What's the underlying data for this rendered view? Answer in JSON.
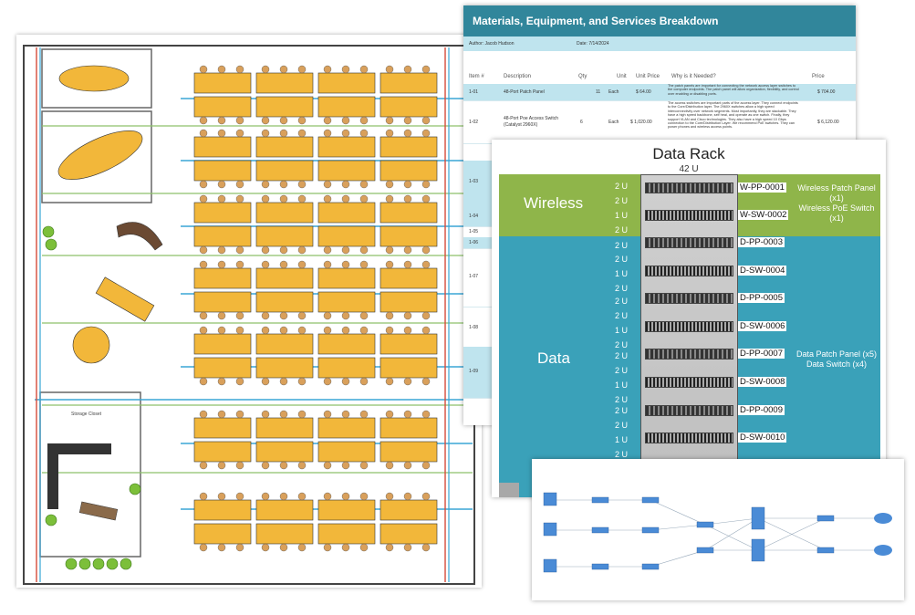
{
  "spreadsheet": {
    "title": "Materials, Equipment, and Services Breakdown",
    "author": "Author: Jacob Hudson",
    "date": "Date: 7/14/2024",
    "headers": [
      "Item #",
      "Description",
      "Qty",
      "Unit",
      "Unit Price",
      "Why is it Needed?",
      "Price"
    ],
    "rows": [
      {
        "item": "1-01",
        "description": "48-Port Patch Panel",
        "qty": "11",
        "unit": "Each",
        "unit_price": "$ 64.00",
        "why": "The patch panels are important for connecting the network access layer switches to the computer endpoints. The patch panel will allow organization, flexibility, and control over enabling or disabling ports.",
        "price": "$ 704.00"
      },
      {
        "item": "1-02",
        "description": "48-Port Poe Access Switch (Catalyst 2960X)",
        "qty": "6",
        "unit": "Each",
        "unit_price": "$ 1,020.00",
        "why": "The access switches are important parts of the access layer. They connect endpoints to the Core/Distribution layer. The 2960X switches allow a high speed interconnectivity over network segments. Most importantly, they are stackable. They have a high speed backbone, self heal, and operate as one switch. Finally, they support VLAN and Cisco technologies. They also have a high speed 10 Gbps connection to the Core/Distribution Layer. We recommend PoE switches. They can power phones and wireless access points.",
        "price": "$ 6,120.00"
      },
      {
        "item": "1-03"
      },
      {
        "item": "1-04"
      },
      {
        "item": "1-05"
      },
      {
        "item": "1-06"
      },
      {
        "item": "1-07"
      },
      {
        "item": "1-08"
      },
      {
        "item": "1-09"
      }
    ]
  },
  "rack": {
    "title": "Data Rack",
    "capacity": "42 U",
    "groups": [
      {
        "label": "Wireless",
        "summary": [
          "Wireless Patch Panel",
          "(x1)",
          "Wireless PoE Switch",
          "(x1)"
        ]
      },
      {
        "label": "Data",
        "summary": [
          "Data Patch Panel (x5)",
          "Data Switch (x4)"
        ]
      }
    ],
    "units": [
      "2 U",
      "2 U",
      "1 U",
      "2 U",
      "2 U",
      "2 U",
      "1 U",
      "2 U",
      "2 U",
      "2 U",
      "1 U",
      "2 U",
      "2 U",
      "2 U",
      "1 U",
      "2 U",
      "2 U",
      "2 U",
      "1 U",
      "2 U"
    ],
    "devices": [
      {
        "id": "W-PP-0001",
        "kind": "patch"
      },
      {
        "id": "W-SW-0002",
        "kind": "switch"
      },
      {
        "id": "D-PP-0003",
        "kind": "patch"
      },
      {
        "id": "D-SW-0004",
        "kind": "switch"
      },
      {
        "id": "D-PP-0005",
        "kind": "patch"
      },
      {
        "id": "D-SW-0006",
        "kind": "switch"
      },
      {
        "id": "D-PP-0007",
        "kind": "patch"
      },
      {
        "id": "D-SW-0008",
        "kind": "switch"
      },
      {
        "id": "D-PP-0009",
        "kind": "patch"
      },
      {
        "id": "D-SW-0010",
        "kind": "switch"
      }
    ]
  },
  "floorplan": {
    "office_label": "Storage Closet"
  },
  "colors": {
    "sheet_header": "#31869b",
    "wireless": "#8fb54a",
    "data": "#3aa1b9",
    "desk": "#f2b73a",
    "chair": "#d9a05b",
    "data_cable": "#3aa6d6",
    "power_cable": "#d64b3a",
    "wireless_cable": "#8dc16a"
  }
}
